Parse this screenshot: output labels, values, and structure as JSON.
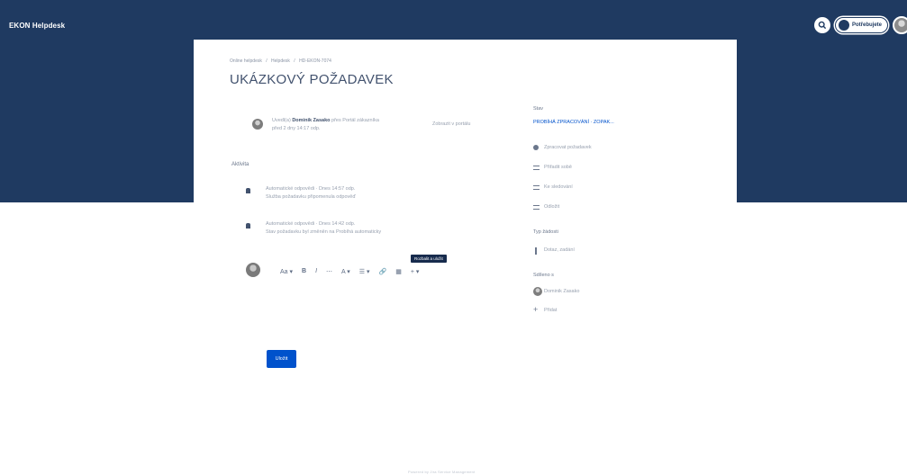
{
  "app": {
    "brand": "EKON Helpdesk",
    "user_pill": "Potřebujete"
  },
  "breadcrumb": [
    "Online helpdesk",
    "/",
    "Helpdesk",
    "/",
    "HD-EKON-7074"
  ],
  "request": {
    "title": "UKÁZKOVÝ POŽADAVEK",
    "reporter_prefix": "Uvedl(a)",
    "reporter_name": "Dominik Zasako",
    "reporter_suffix": "přes Portál zákazníka",
    "reporter_date": "před 2 dny 14:17 odp.",
    "view_link": "Zobrazit v portálu"
  },
  "activity": {
    "label": "Aktivita",
    "items": [
      {
        "line1": "Automatické odpovědi · Dnes 14:57 odp.",
        "line2": "Služba požadavku připomenula odpověď"
      },
      {
        "line1": "Automatické odpovědi · Dnes 14:42 odp.",
        "line2": "Stav požadavku byl změněn na Probíhá automaticky"
      }
    ]
  },
  "editor": {
    "tooltip": "Rozbalit a uložit",
    "toolbar": [
      "Aa ▾",
      "B",
      "I",
      "⋯",
      "A ▾",
      "☰ ▾",
      "🔗",
      "▦",
      "+ ▾"
    ],
    "save_label": "Uložit"
  },
  "sidebar": {
    "status_label": "Stav",
    "status_value": "PROBÍHÁ ZPRACOVÁNÍ · ZOPAK...",
    "actions": [
      "Zpracovat požadavek",
      "Přiřadit sobě",
      "Ke sledování",
      "Odložit"
    ],
    "type_label": "Typ žádosti",
    "type_value": "Dotaz, zadání",
    "shared_label": "Sdíleno s",
    "shared_user": "Dominik Zasako",
    "add_label": "Přidat"
  },
  "footer": "Powered by Jira Service Management"
}
